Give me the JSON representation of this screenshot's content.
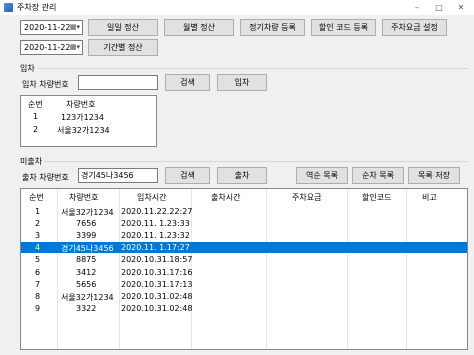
{
  "window": {
    "title": "주차장 관리",
    "minimize": "–",
    "maximize": "□",
    "close": "✕"
  },
  "top": {
    "date1": "2020-11-22",
    "date2": "2020-11-22",
    "buttons": {
      "daily": "일일 정산",
      "monthly": "월별 정산",
      "regular": "정기차량 등록",
      "discount": "할인 코드 등록",
      "fee_setting": "주차요금 설정",
      "period": "기간별 정산"
    }
  },
  "entry": {
    "group_label": "입차",
    "car_number_label": "입차 차량번호",
    "car_number_value": "",
    "search_button": "검색",
    "enter_button": "입차",
    "list_headers": [
      "순번",
      "차량번호"
    ],
    "rows": [
      {
        "no": "1",
        "car": "123가1234"
      },
      {
        "no": "2",
        "car": "서울32가1234"
      }
    ]
  },
  "unsettled": {
    "group_label": "미출차",
    "car_number_label": "출차 차량번호",
    "car_number_value": "경기45나3456",
    "search_button": "검색",
    "exit_button": "출차",
    "reverse_button": "역순 목록",
    "forward_button": "순차 목록",
    "save_button": "목록 저장",
    "headers": [
      "순번",
      "차량번호",
      "입차시간",
      "출차시간",
      "주차요금",
      "할인코드",
      "비고"
    ],
    "rows": [
      {
        "no": "1",
        "car": "서울32가1234",
        "in": "2020.11.22.22:27",
        "selected": false
      },
      {
        "no": "2",
        "car": "7656",
        "in": "2020.11. 1.23:33",
        "selected": false
      },
      {
        "no": "3",
        "car": "3399",
        "in": "2020.11. 1.23:32",
        "selected": false
      },
      {
        "no": "4",
        "car": "경기45나3456",
        "in": "2020.11. 1.17:27",
        "selected": true
      },
      {
        "no": "5",
        "car": "8875",
        "in": "2020.10.31.18:57",
        "selected": false
      },
      {
        "no": "6",
        "car": "3412",
        "in": "2020.10.31.17:16",
        "selected": false
      },
      {
        "no": "7",
        "car": "5656",
        "in": "2020.10.31.17:13",
        "selected": false
      },
      {
        "no": "8",
        "car": "서울32가1234",
        "in": "2020.10.31.02:48",
        "selected": false
      },
      {
        "no": "9",
        "car": "3322",
        "in": "2020.10.31.02:48",
        "selected": false
      }
    ]
  }
}
